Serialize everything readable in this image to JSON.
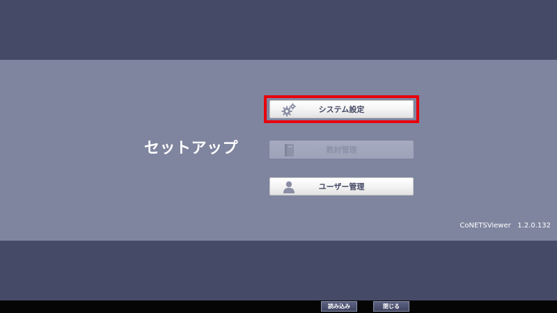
{
  "page": {
    "title": "セットアップ",
    "version": "CoNETSViewer   1.2.0.132"
  },
  "menu": {
    "system_settings": {
      "label": "システム設定",
      "icon": "gears-icon",
      "state": "selected"
    },
    "material_management": {
      "label": "教材管理",
      "icon": "book-icon",
      "state": "disabled"
    },
    "user_management": {
      "label": "ユーザー管理",
      "icon": "user-icon",
      "state": "enabled"
    }
  },
  "footer": {
    "load_label": "読み込み",
    "close_label": "閉じる"
  },
  "colors": {
    "background_dark": "#454a66",
    "background_center": "#7f859f",
    "highlight": "#e8000b",
    "footer_bar": "#050505"
  }
}
